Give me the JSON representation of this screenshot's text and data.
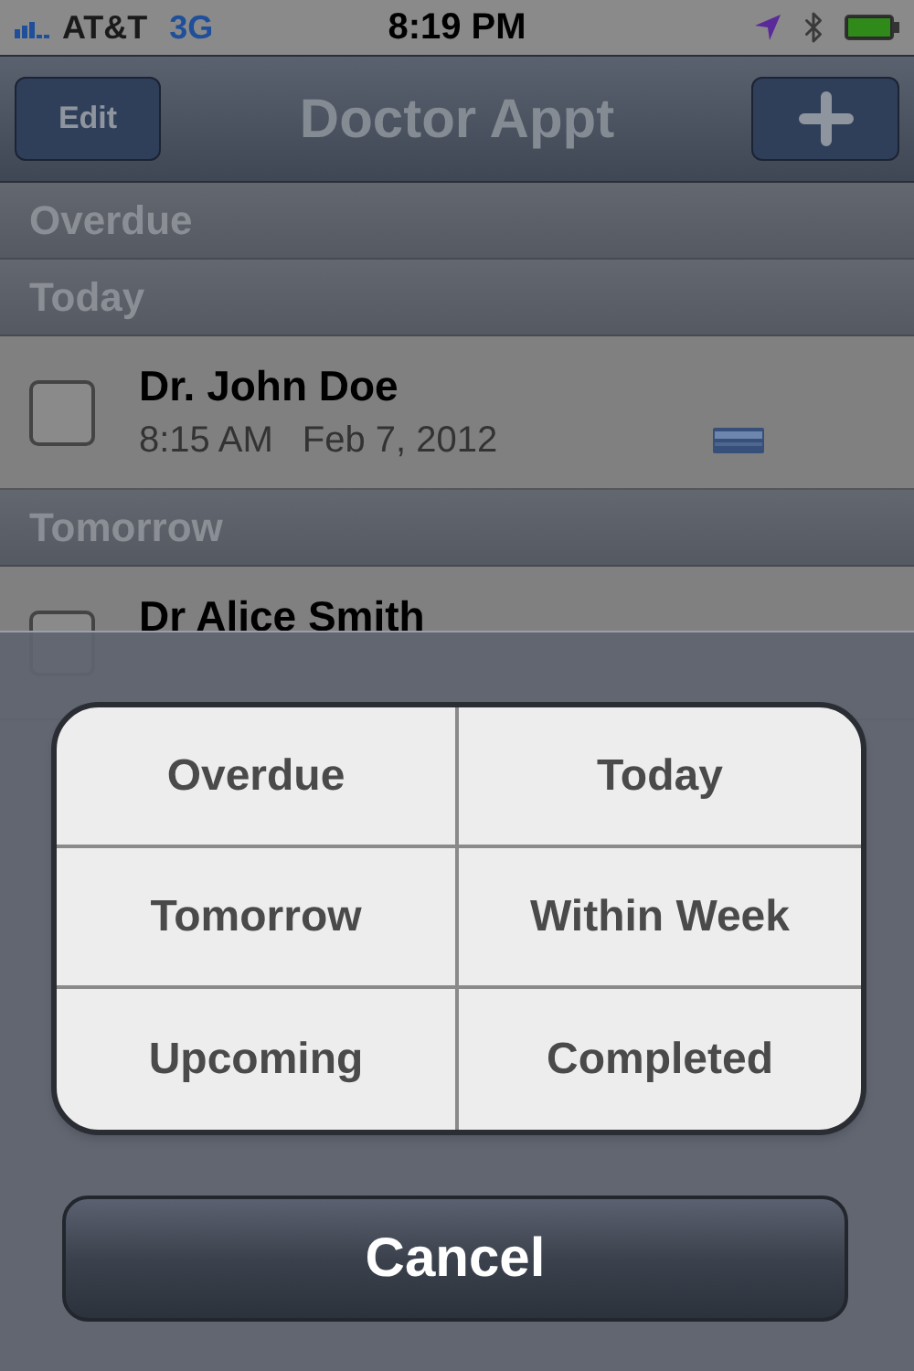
{
  "status_bar": {
    "carrier": "AT&T",
    "network": "3G",
    "time": "8:19 PM"
  },
  "nav_bar": {
    "left_button": "Edit",
    "title": "Doctor Appt"
  },
  "sections": [
    {
      "title": "Overdue"
    },
    {
      "title": "Today",
      "items": [
        {
          "name": "Dr. John Doe",
          "time": "8:15 AM",
          "date": "Feb 7, 2012",
          "checked": false
        }
      ]
    },
    {
      "title": "Tomorrow",
      "items": [
        {
          "name": "Dr Alice Smith",
          "checked": false
        }
      ]
    }
  ],
  "action_sheet": {
    "options": [
      "Overdue",
      "Today",
      "Tomorrow",
      "Within Week",
      "Upcoming",
      "Completed"
    ],
    "cancel": "Cancel"
  }
}
